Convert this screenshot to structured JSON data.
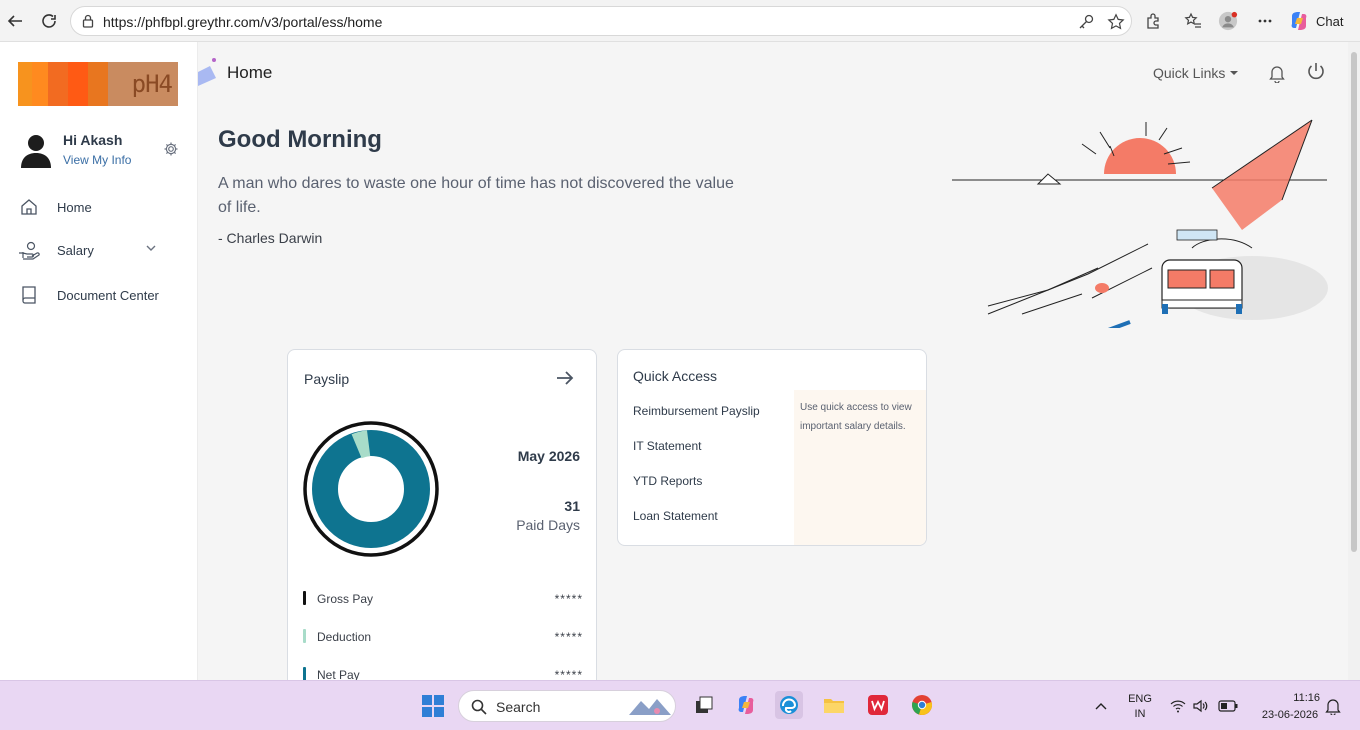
{
  "browser": {
    "url": "https://phfbpl.greythr.com/v3/portal/ess/home",
    "chat_label": "Chat"
  },
  "sidebar": {
    "logo_text": "pH4",
    "greeting": "Hi Akash",
    "view_info": "View My Info",
    "items": [
      {
        "label": "Home",
        "icon": "home-icon"
      },
      {
        "label": "Salary",
        "icon": "hand-money-icon"
      },
      {
        "label": "Document Center",
        "icon": "book-icon"
      }
    ]
  },
  "header": {
    "title": "Home",
    "quick_links": "Quick Links"
  },
  "main": {
    "greeting": "Good Morning",
    "quote": "A man who dares to waste one hour of time has not discovered the value of life.",
    "author": "- Charles Darwin"
  },
  "payslip": {
    "title": "Payslip",
    "period": "May 2026",
    "paid_days_value": "31",
    "paid_days_label": "Paid Days",
    "rows": [
      {
        "label": "Gross Pay",
        "value": "*****",
        "color": "#111111"
      },
      {
        "label": "Deduction",
        "value": "*****",
        "color": "#a8dcc9"
      },
      {
        "label": "Net Pay",
        "value": "*****",
        "color": "#0e7490"
      }
    ]
  },
  "quick_access": {
    "title": "Quick Access",
    "links": [
      "Reimbursement Payslip",
      "IT Statement",
      "YTD Reports",
      "Loan Statement"
    ],
    "note": "Use quick access to view important salary details."
  },
  "taskbar": {
    "search": "Search",
    "lang_1": "ENG",
    "lang_2": "IN",
    "time": "11:16",
    "date": "23-06-2026"
  },
  "colors": {
    "accent": "#0e7490",
    "link": "#3a6ea5",
    "deduction": "#a8dcc9",
    "sun": "#f47b67"
  }
}
